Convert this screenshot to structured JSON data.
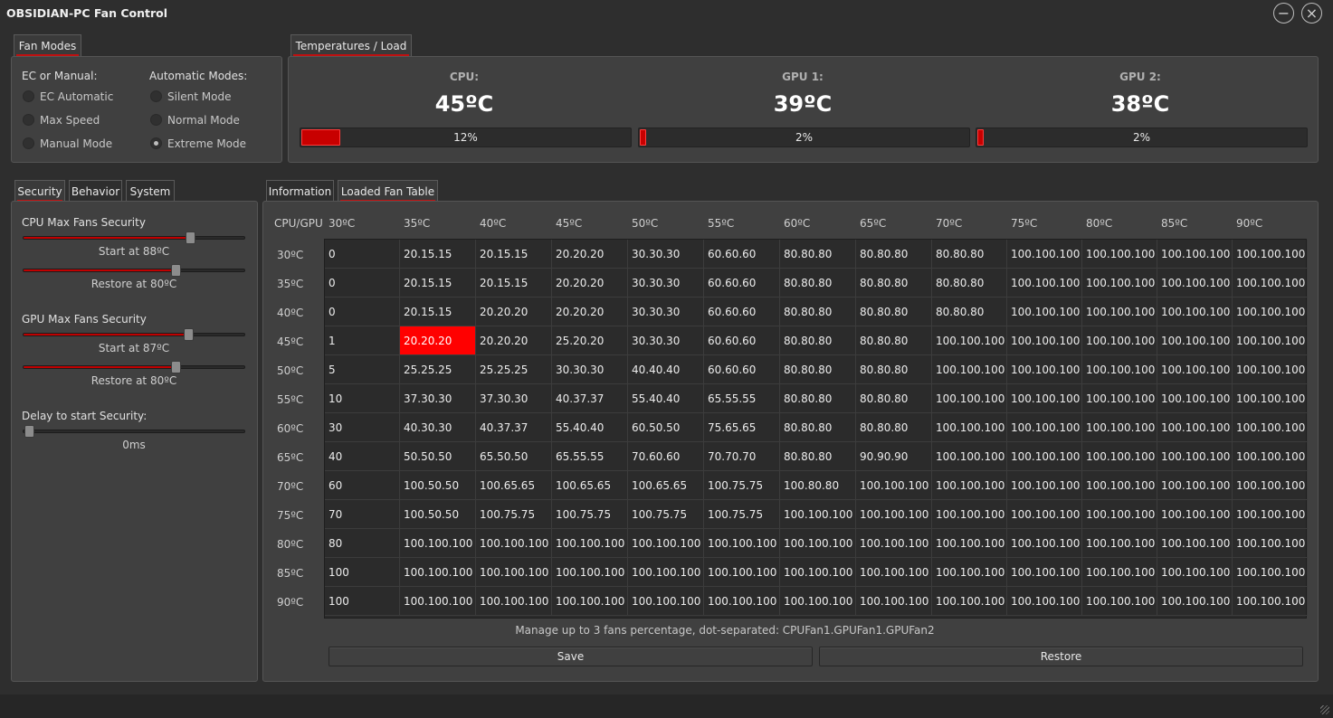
{
  "window": {
    "title": "OBSIDIAN-PC Fan Control",
    "minimize_glyph": "−",
    "close_glyph": "×"
  },
  "fan_modes": {
    "tab": "Fan Modes",
    "ec_header": "EC or Manual:",
    "auto_header": "Automatic Modes:",
    "ec_options": [
      "EC Automatic",
      "Max Speed",
      "Manual Mode"
    ],
    "auto_options": [
      "Silent Mode",
      "Normal Mode",
      "Extreme Mode"
    ],
    "selected": "Extreme Mode"
  },
  "temps": {
    "tab": "Temperatures / Load",
    "sensors": [
      {
        "name": "CPU:",
        "temp": "45ºC",
        "load_label": "12%",
        "load": 12
      },
      {
        "name": "GPU 1:",
        "temp": "39ºC",
        "load_label": "2%",
        "load": 2
      },
      {
        "name": "GPU 2:",
        "temp": "38ºC",
        "load_label": "2%",
        "load": 2
      }
    ]
  },
  "left_tabs": [
    "Security",
    "Behavior",
    "System"
  ],
  "security": {
    "cpu_title": "CPU Max Fans Security",
    "cpu_start": "Start at 88ºC",
    "cpu_start_value": 88,
    "cpu_restore": "Restore at 80ºC",
    "cpu_restore_value": 80,
    "gpu_title": "GPU Max Fans Security",
    "gpu_start": "Start at 87ºC",
    "gpu_start_value": 87,
    "gpu_restore": "Restore at 80ºC",
    "gpu_restore_value": 80,
    "delay_title": "Delay to start Security:",
    "delay_value": "0ms"
  },
  "right_tabs": [
    "Information",
    "Loaded Fan Table"
  ],
  "fan_table": {
    "corner": "CPU/GPU",
    "columns": [
      "30ºC",
      "35ºC",
      "40ºC",
      "45ºC",
      "50ºC",
      "55ºC",
      "60ºC",
      "65ºC",
      "70ºC",
      "75ºC",
      "80ºC",
      "85ºC",
      "90ºC"
    ],
    "rows": [
      "30ºC",
      "35ºC",
      "40ºC",
      "45ºC",
      "50ºC",
      "55ºC",
      "60ºC",
      "65ºC",
      "70ºC",
      "75ºC",
      "80ºC",
      "85ºC",
      "90ºC"
    ],
    "cells": [
      [
        "0",
        "20.15.15",
        "20.15.15",
        "20.20.20",
        "30.30.30",
        "60.60.60",
        "80.80.80",
        "80.80.80",
        "80.80.80",
        "100.100.100",
        "100.100.100",
        "100.100.100",
        "100.100.100"
      ],
      [
        "0",
        "20.15.15",
        "20.15.15",
        "20.20.20",
        "30.30.30",
        "60.60.60",
        "80.80.80",
        "80.80.80",
        "80.80.80",
        "100.100.100",
        "100.100.100",
        "100.100.100",
        "100.100.100"
      ],
      [
        "0",
        "20.15.15",
        "20.20.20",
        "20.20.20",
        "30.30.30",
        "60.60.60",
        "80.80.80",
        "80.80.80",
        "80.80.80",
        "100.100.100",
        "100.100.100",
        "100.100.100",
        "100.100.100"
      ],
      [
        "1",
        "20.20.20",
        "20.20.20",
        "25.20.20",
        "30.30.30",
        "60.60.60",
        "80.80.80",
        "80.80.80",
        "100.100.100",
        "100.100.100",
        "100.100.100",
        "100.100.100",
        "100.100.100"
      ],
      [
        "5",
        "25.25.25",
        "25.25.25",
        "30.30.30",
        "40.40.40",
        "60.60.60",
        "80.80.80",
        "80.80.80",
        "100.100.100",
        "100.100.100",
        "100.100.100",
        "100.100.100",
        "100.100.100"
      ],
      [
        "10",
        "37.30.30",
        "37.30.30",
        "40.37.37",
        "55.40.40",
        "65.55.55",
        "80.80.80",
        "80.80.80",
        "100.100.100",
        "100.100.100",
        "100.100.100",
        "100.100.100",
        "100.100.100"
      ],
      [
        "30",
        "40.30.30",
        "40.37.37",
        "55.40.40",
        "60.50.50",
        "75.65.65",
        "80.80.80",
        "80.80.80",
        "100.100.100",
        "100.100.100",
        "100.100.100",
        "100.100.100",
        "100.100.100"
      ],
      [
        "40",
        "50.50.50",
        "65.50.50",
        "65.55.55",
        "70.60.60",
        "70.70.70",
        "80.80.80",
        "90.90.90",
        "100.100.100",
        "100.100.100",
        "100.100.100",
        "100.100.100",
        "100.100.100"
      ],
      [
        "60",
        "100.50.50",
        "100.65.65",
        "100.65.65",
        "100.65.65",
        "100.75.75",
        "100.80.80",
        "100.100.100",
        "100.100.100",
        "100.100.100",
        "100.100.100",
        "100.100.100",
        "100.100.100"
      ],
      [
        "70",
        "100.50.50",
        "100.75.75",
        "100.75.75",
        "100.75.75",
        "100.75.75",
        "100.100.100",
        "100.100.100",
        "100.100.100",
        "100.100.100",
        "100.100.100",
        "100.100.100",
        "100.100.100"
      ],
      [
        "80",
        "100.100.100",
        "100.100.100",
        "100.100.100",
        "100.100.100",
        "100.100.100",
        "100.100.100",
        "100.100.100",
        "100.100.100",
        "100.100.100",
        "100.100.100",
        "100.100.100",
        "100.100.100"
      ],
      [
        "100",
        "100.100.100",
        "100.100.100",
        "100.100.100",
        "100.100.100",
        "100.100.100",
        "100.100.100",
        "100.100.100",
        "100.100.100",
        "100.100.100",
        "100.100.100",
        "100.100.100",
        "100.100.100"
      ],
      [
        "100",
        "100.100.100",
        "100.100.100",
        "100.100.100",
        "100.100.100",
        "100.100.100",
        "100.100.100",
        "100.100.100",
        "100.100.100",
        "100.100.100",
        "100.100.100",
        "100.100.100",
        "100.100.100"
      ]
    ],
    "highlight": {
      "row": 3,
      "col": 1
    },
    "note": "Manage up to 3 fans percentage, dot-separated: CPUFan1.GPUFan1.GPUFan2",
    "save_label": "Save",
    "restore_label": "Restore"
  },
  "colors": {
    "accent": "#c80000",
    "highlight": "#ff0000",
    "background": "#2e2e2e",
    "panel": "#404040"
  }
}
